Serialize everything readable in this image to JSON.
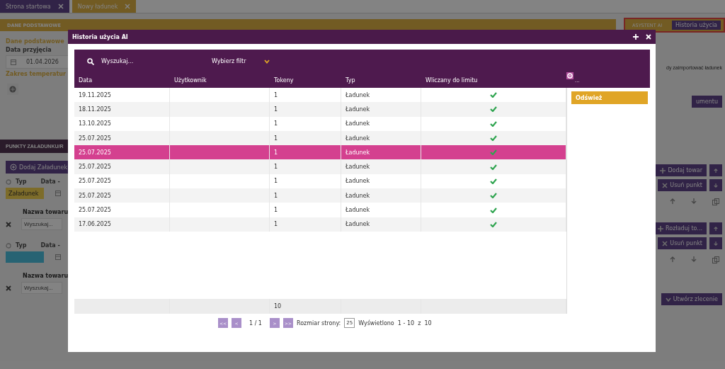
{
  "app_tabs": [
    {
      "label": "Strona startowa"
    },
    {
      "label": "Nowy ładunek"
    }
  ],
  "basic_section": {
    "header": "DANE PODSTAWOWE",
    "subtitle": "Dane podstawowe",
    "date_label": "Data przyjęcia",
    "date_value": "01.04.2026",
    "temp_label": "Zakres temperatur"
  },
  "ai_assistant": {
    "label": "ASYSTENT AI",
    "history_button": "Historia użycia",
    "highlighted": true
  },
  "right_panel": {
    "hint": "dy zaimportować ładunek",
    "doc_button": "umentu"
  },
  "points_section": {
    "header": "PUNKTY ZAŁADUNKU/R",
    "add_button": "Dodaj Załadunek",
    "points": [
      {
        "type_label": "Typ",
        "date_label": "Data -",
        "type_value": "Załadunek",
        "kind": "loading",
        "goods_label": "Nazwa towaru",
        "search_placeholder": "Wyszukaj...",
        "add_goods_button": "Dodaj towar",
        "remove_button": "Usuń punkt"
      },
      {
        "type_label": "Typ",
        "date_label": "Data -",
        "kind": "unloading",
        "goods_label": "Nazwa towaru",
        "search_placeholder": "Wyszukaj...",
        "add_goods_button": "Rozładuj to...",
        "remove_button": "Usuń punkt"
      }
    ]
  },
  "create_button": "Utwórz zlecenie",
  "dialog": {
    "title": "Historia użycia AI",
    "search": {
      "placeholder": "Wyszukaj..."
    },
    "filter": {
      "placeholder": "Wybierz filtr"
    },
    "columns": [
      "Data",
      "Użytkownik",
      "Tokeny",
      "Typ",
      "Wliczany do limitu"
    ],
    "more_label": "...",
    "refresh_button": "Odśwież",
    "rows": [
      {
        "date": "19.11.2025",
        "tokens": "1",
        "type": "Ładunek",
        "counted": true,
        "selected": false
      },
      {
        "date": "18.11.2025",
        "tokens": "1",
        "type": "Ładunek",
        "counted": true,
        "selected": false
      },
      {
        "date": "13.10.2025",
        "tokens": "1",
        "type": "Ładunek",
        "counted": true,
        "selected": false
      },
      {
        "date": "25.07.2025",
        "tokens": "1",
        "type": "Ładunek",
        "counted": true,
        "selected": false
      },
      {
        "date": "25.07.2025",
        "tokens": "1",
        "type": "Ładunek",
        "counted": true,
        "selected": true
      },
      {
        "date": "25.07.2025",
        "tokens": "1",
        "type": "Ładunek",
        "counted": true,
        "selected": false
      },
      {
        "date": "25.07.2025",
        "tokens": "1",
        "type": "Ładunek",
        "counted": true,
        "selected": false
      },
      {
        "date": "25.07.2025",
        "tokens": "1",
        "type": "Ładunek",
        "counted": true,
        "selected": false
      },
      {
        "date": "25.07.2025",
        "tokens": "1",
        "type": "Ładunek",
        "counted": true,
        "selected": false
      },
      {
        "date": "17.06.2025",
        "tokens": "1",
        "type": "Ładunek",
        "counted": true,
        "selected": false
      }
    ],
    "footer": {
      "tokens_total": "10"
    },
    "pager": {
      "first": "<<",
      "prev": "<",
      "page": "1 / 1",
      "next": ">",
      "last": ">>",
      "size_label": "Rozmiar strony:",
      "size_value": "25",
      "summary": "Wyświetlono  1 - 10  z  10"
    }
  }
}
